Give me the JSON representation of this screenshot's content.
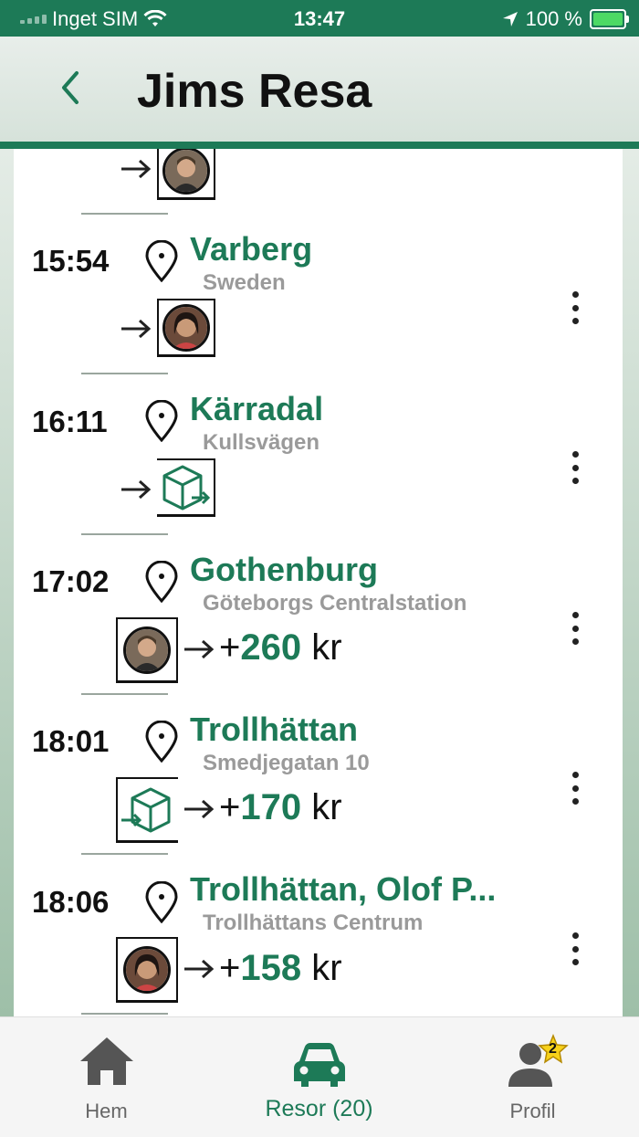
{
  "status_bar": {
    "carrier": "Inget SIM",
    "time": "13:47",
    "battery": "100 %"
  },
  "header": {
    "title": "Jims Resa"
  },
  "stops": [
    {
      "time": "15:54",
      "city": "Varberg",
      "subtitle": "Sweden"
    },
    {
      "time": "16:11",
      "city": "Kärradal",
      "subtitle": "Kullsvägen"
    },
    {
      "time": "17:02",
      "city": "Gothenburg",
      "subtitle": "Göteborgs Centralstation",
      "amount": "260",
      "currency": "kr"
    },
    {
      "time": "18:01",
      "city": "Trollhättan",
      "subtitle": "Smedjegatan 10",
      "amount": "170",
      "currency": "kr"
    },
    {
      "time": "18:06",
      "city": "Trollhättan, Olof P...",
      "subtitle": "Trollhättans Centrum",
      "amount": "158",
      "currency": "kr"
    }
  ],
  "tabs": [
    {
      "label": "Hem",
      "icon": "home-icon"
    },
    {
      "label": "Resor (20)",
      "icon": "car-icon"
    },
    {
      "label": "Profil",
      "icon": "user-icon",
      "badge": "2"
    }
  ],
  "colors": {
    "brand": "#1d7a57",
    "muted": "#9a9a9a"
  }
}
